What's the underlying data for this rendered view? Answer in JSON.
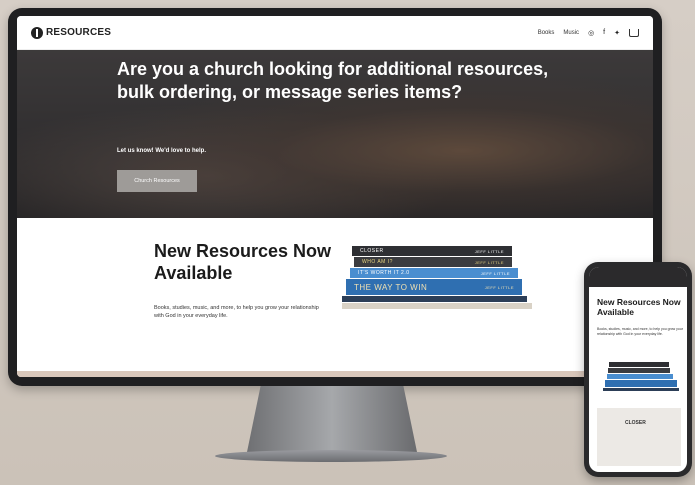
{
  "nav": {
    "logo": "RESOURCES",
    "links": [
      "Books",
      "Music"
    ]
  },
  "hero": {
    "title": "Are you a church looking for additional resources, bulk ordering, or message series items?",
    "subtitle": "Let us know! We'd love to help.",
    "button": "Church Resources"
  },
  "section": {
    "title": "New Resources Now Available",
    "description": "Books, studies, music, and more, to help you grow your relationship with God in your everyday life."
  },
  "books": [
    {
      "title": "CLOSER",
      "author": "JEFF LITTLE"
    },
    {
      "title": "WHO AM I?",
      "author": "JEFF LITTLE"
    },
    {
      "title": "IT'S WORTH IT 2.0",
      "author": "JEFF LITTLE"
    },
    {
      "title": "THE WAY TO WIN",
      "author": "JEFF LITTLE"
    }
  ],
  "phone": {
    "title": "New Resources Now Available",
    "description": "Books, studies, music, and more, to help you grow your relationship with God in your everyday life.",
    "card_title": "CLOSER"
  }
}
